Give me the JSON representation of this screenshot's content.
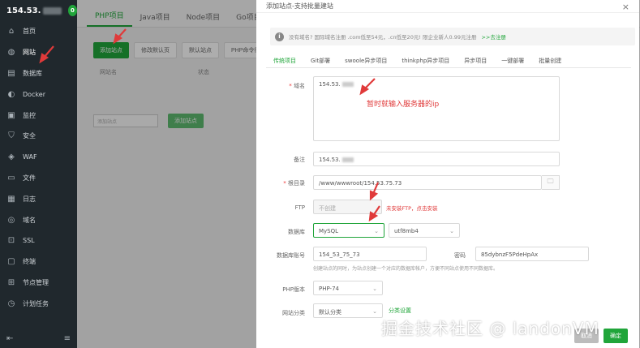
{
  "sidebar": {
    "server_ip": "154.53.",
    "badge": "0",
    "items": [
      {
        "label": "首页",
        "icon": "home-icon"
      },
      {
        "label": "网站",
        "icon": "globe-icon",
        "active": true
      },
      {
        "label": "数据库",
        "icon": "database-icon"
      },
      {
        "label": "Docker",
        "icon": "docker-icon"
      },
      {
        "label": "监控",
        "icon": "monitor-icon"
      },
      {
        "label": "安全",
        "icon": "shield-icon"
      },
      {
        "label": "WAF",
        "icon": "waf-icon"
      },
      {
        "label": "文件",
        "icon": "folder-icon"
      },
      {
        "label": "日志",
        "icon": "log-icon"
      },
      {
        "label": "域名",
        "icon": "domain-icon"
      },
      {
        "label": "SSL",
        "icon": "ssl-icon"
      },
      {
        "label": "终端",
        "icon": "terminal-icon"
      },
      {
        "label": "节点管理",
        "icon": "node-icon"
      },
      {
        "label": "计划任务",
        "icon": "clock-icon"
      }
    ]
  },
  "page": {
    "tabs": [
      "PHP项目",
      "Java项目",
      "Node项目",
      "Go项目"
    ],
    "toolbar": [
      "添加站点",
      "修改默认页",
      "默认站点",
      "PHP命令行版本"
    ],
    "table_headers": [
      "网站名",
      "状态"
    ],
    "empty_placeholder": "添加站点",
    "empty_button": "添加站点"
  },
  "modal": {
    "title": "添加站点-支持批量建站",
    "close": "×",
    "notice": "没有域名? 国际域名注册 .com低至54元，.cn低至20元! 限企业新人0.99元注册",
    "notice_link": ">>去注册",
    "tabs": [
      "传统项目",
      "Git部署",
      "swoole异步项目",
      "thinkphp异步项目",
      "异步项目",
      "一键部署",
      "批量创建"
    ],
    "fields": {
      "domain_label": "域名",
      "domain_value": "154.53.",
      "domain_annotation": "暂时就输入服务器的ip",
      "remark_label": "备注",
      "remark_value": "154.53.",
      "root_label": "根目录",
      "root_value": "/www/wwwroot/154.53.75.73",
      "ftp_label": "FTP",
      "ftp_value": "不创建",
      "ftp_note": "未安装FTP，点击安装",
      "db_label": "数据库",
      "db_value": "MySQL",
      "db_charset": "utf8mb4",
      "db_account_label": "数据库账号",
      "db_account_value": "154_53_75_73",
      "db_password_label": "密码",
      "db_password_value": "85dybnzF5PdeHpAx",
      "db_hint": "创建站点的同时，为站点创建一个对应的数据库帐户，方便不同站点使用不同数据库。",
      "php_label": "PHP版本",
      "php_value": "PHP-74",
      "category_label": "网站分类",
      "category_value": "默认分类",
      "category_link": "分类设置"
    },
    "cancel": "取消",
    "confirm": "确定"
  },
  "watermark": "掘金技术社区 @ landonVM",
  "colors": {
    "accent": "#20a53a",
    "annotation": "#e03a3a",
    "sidebar": "#20282d"
  }
}
